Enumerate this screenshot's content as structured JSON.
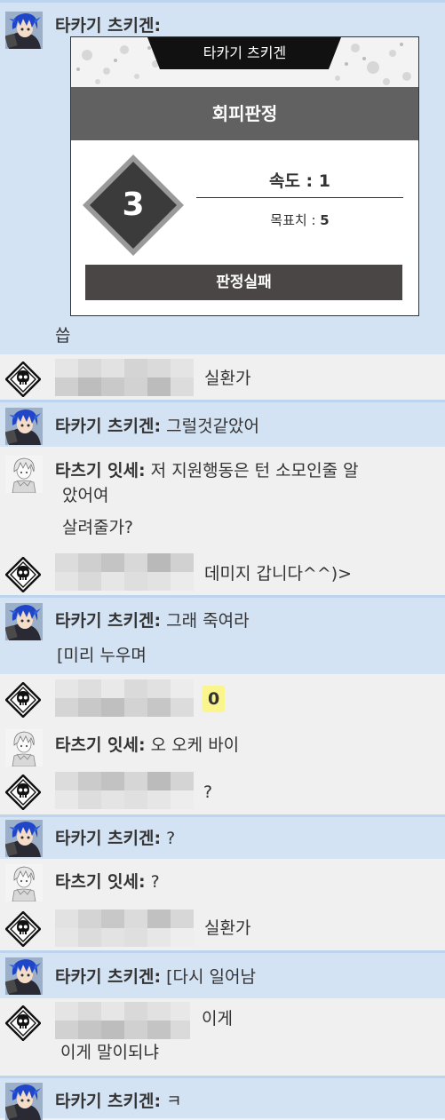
{
  "speakers": {
    "takagi": "타카기 츠키겐:",
    "itsuse": "타츠기 잇세:"
  },
  "card": {
    "tag": "타카기 츠키겐",
    "title": "회피판정",
    "number": "3",
    "stat_label": "속도 : ",
    "stat_value": "1",
    "target_label": "목표치 : ",
    "target_value": "5",
    "result": "판정실패"
  },
  "messages": [
    {
      "speaker": "takagi",
      "lines": [
        "",
        "씁"
      ]
    },
    {
      "speaker": "redacted",
      "lines": [
        "실환가"
      ]
    },
    {
      "speaker": "takagi",
      "lines": [
        "그럴것같았어"
      ]
    },
    {
      "speaker": "itsuse",
      "lines": [
        "저 지원행동은 턴 소모인줄 알",
        "았어여",
        "살려줄가?"
      ]
    },
    {
      "speaker": "redacted",
      "lines": [
        "데미지 갑니다^^)>"
      ]
    },
    {
      "speaker": "takagi",
      "lines": [
        "그래 죽여라",
        "[미리 누우며"
      ]
    },
    {
      "speaker": "redacted",
      "lines": [
        "0"
      ]
    },
    {
      "speaker": "itsuse",
      "lines": [
        "오 오케 바이"
      ]
    },
    {
      "speaker": "redacted",
      "lines": [
        "?"
      ]
    },
    {
      "speaker": "takagi",
      "lines": [
        "?"
      ]
    },
    {
      "speaker": "itsuse",
      "lines": [
        "?"
      ]
    },
    {
      "speaker": "redacted",
      "lines": [
        "실환가"
      ]
    },
    {
      "speaker": "takagi",
      "lines": [
        "[다시 일어남"
      ]
    },
    {
      "speaker": "redacted",
      "lines": [
        "이게",
        "이게 말이되냐"
      ]
    },
    {
      "speaker": "takagi",
      "lines": [
        "ㅋ"
      ]
    }
  ],
  "icons": {
    "takagi_avatar": "blue-haired-character-avatar",
    "itsuse_avatar": "white-haired-character-avatar",
    "redacted_avatar": "skull-diamond-icon"
  },
  "colors": {
    "blue_row": "#d4e3f4",
    "gray_row": "#f0f0f0",
    "separator": "#bcd4ee",
    "card_band": "#616161",
    "card_result": "#4b4646",
    "badge": "#fbf58e"
  }
}
